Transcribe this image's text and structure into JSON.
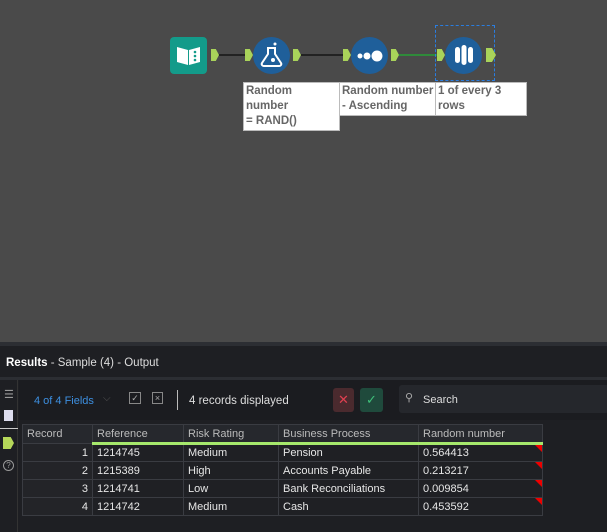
{
  "workflow": {
    "tools": [
      {
        "name": "input-data",
        "icon": "book-icon"
      },
      {
        "name": "formula",
        "icon": "flask-icon",
        "label_line1": "Random number",
        "label_line2": "= RAND()"
      },
      {
        "name": "sort",
        "icon": "dots-icon",
        "label_line1": "Random number",
        "label_line2": "- Ascending"
      },
      {
        "name": "sample",
        "icon": "test-tubes-icon",
        "label_line1": "1 of every 3 rows"
      }
    ]
  },
  "results": {
    "title_bold": "Results",
    "title_rest": " - Sample (4) - Output",
    "fields_selector": "4 of 4 Fields",
    "records_displayed": "4 records displayed",
    "search_placeholder": "Search",
    "columns": [
      "Record",
      "Reference",
      "Risk Rating",
      "Business Process",
      "Random number"
    ],
    "rows": [
      [
        "1",
        "1214745",
        "Medium",
        "Pension",
        "0.564413"
      ],
      [
        "2",
        "1215389",
        "High",
        "Accounts Payable",
        "0.213217"
      ],
      [
        "3",
        "1214741",
        "Low",
        "Bank Reconciliations",
        "0.009854"
      ],
      [
        "4",
        "1214742",
        "Medium",
        "Cash",
        "0.453592"
      ]
    ]
  }
}
